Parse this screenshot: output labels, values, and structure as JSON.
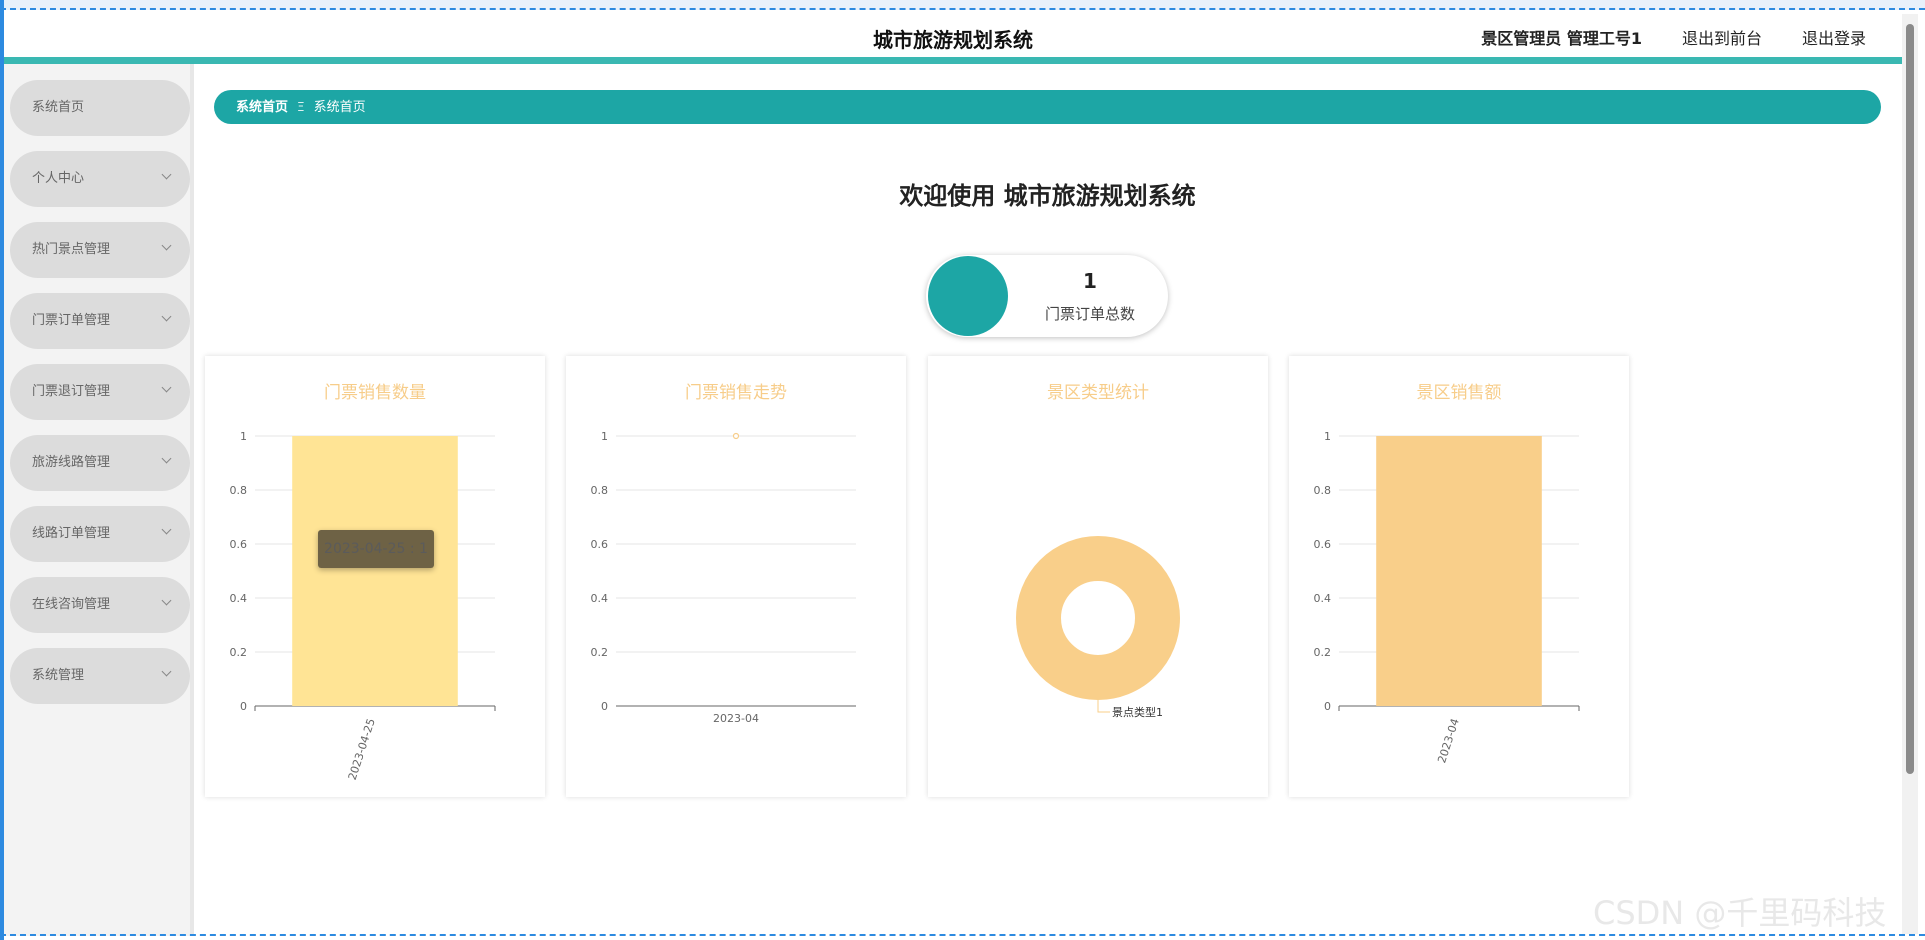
{
  "header": {
    "title": "城市旅游规划系统",
    "user": "景区管理员 管理工号1",
    "front_link": "退出到前台",
    "logout_link": "退出登录"
  },
  "sidebar": {
    "items": [
      {
        "label": "系统首页",
        "has_children": false
      },
      {
        "label": "个人中心",
        "has_children": true
      },
      {
        "label": "热门景点管理",
        "has_children": true
      },
      {
        "label": "门票订单管理",
        "has_children": true
      },
      {
        "label": "门票退订管理",
        "has_children": true
      },
      {
        "label": "旅游线路管理",
        "has_children": true
      },
      {
        "label": "线路订单管理",
        "has_children": true
      },
      {
        "label": "在线咨询管理",
        "has_children": true
      },
      {
        "label": "系统管理",
        "has_children": true
      }
    ]
  },
  "breadcrumb": {
    "home": "系统首页",
    "separator": "Ξ",
    "current": "系统首页"
  },
  "welcome": "欢迎使用 城市旅游规划系统",
  "stat": {
    "value": "1",
    "label": "门票订单总数"
  },
  "tooltip": "2023-04-25 : 1",
  "watermark": "CSDN @千里码科技",
  "colors": {
    "teal": "#1da6a5",
    "bar1": "#ffe495",
    "bar2": "#f9cf8a",
    "title": "#f7cd8a"
  },
  "chart_data": [
    {
      "type": "bar",
      "title": "门票销售数量",
      "categories": [
        "2023-04-25"
      ],
      "values": [
        1
      ],
      "ylim": [
        0,
        1
      ],
      "yticks": [
        "0",
        "0.2",
        "0.4",
        "0.6",
        "0.8",
        "1"
      ],
      "xlabel": "",
      "ylabel": "",
      "grid": true,
      "x_label_rotated": true
    },
    {
      "type": "line",
      "title": "门票销售走势",
      "categories": [
        "2023-04"
      ],
      "values": [
        1
      ],
      "ylim": [
        0,
        1
      ],
      "yticks": [
        "0",
        "0.2",
        "0.4",
        "0.6",
        "0.8",
        "1"
      ],
      "xlabel": "",
      "ylabel": "",
      "grid": true,
      "x_label_rotated": false
    },
    {
      "type": "pie",
      "title": "景区类型统计",
      "labels": [
        "景点类型1"
      ],
      "values": [
        1
      ],
      "donut": true
    },
    {
      "type": "bar",
      "title": "景区销售额",
      "categories": [
        "2023-04"
      ],
      "values": [
        1
      ],
      "ylim": [
        0,
        1
      ],
      "yticks": [
        "0",
        "0.2",
        "0.4",
        "0.6",
        "0.8",
        "1"
      ],
      "xlabel": "",
      "ylabel": "",
      "grid": true,
      "x_label_rotated": true
    }
  ]
}
